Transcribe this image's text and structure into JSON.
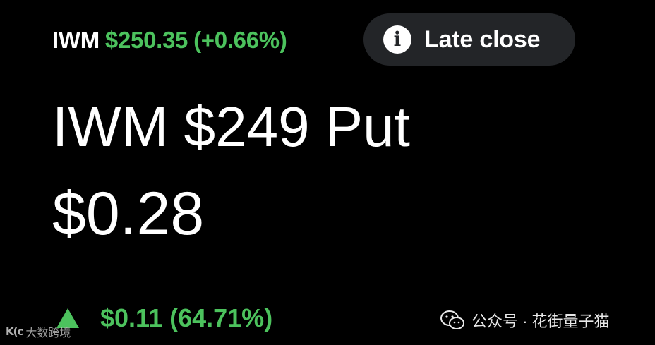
{
  "header": {
    "ticker": "IWM",
    "price": "$250.35",
    "change": "(+0.66%)"
  },
  "status_pill": {
    "icon": "info-icon",
    "label": "Late close"
  },
  "title": "IWM $249 Put",
  "option_price": "$0.28",
  "change_row": {
    "icon": "up-arrow-icon",
    "value": "$0.11 (64.71%)"
  },
  "watermark_left": {
    "logo": "K(c",
    "text": "大数跨境"
  },
  "watermark_right": {
    "icon": "wechat-icon",
    "text": "公众号 · 花街量子猫"
  },
  "colors": {
    "positive": "#4cc25d",
    "background": "#000000",
    "pill_background": "#232528",
    "text": "#ffffff"
  }
}
